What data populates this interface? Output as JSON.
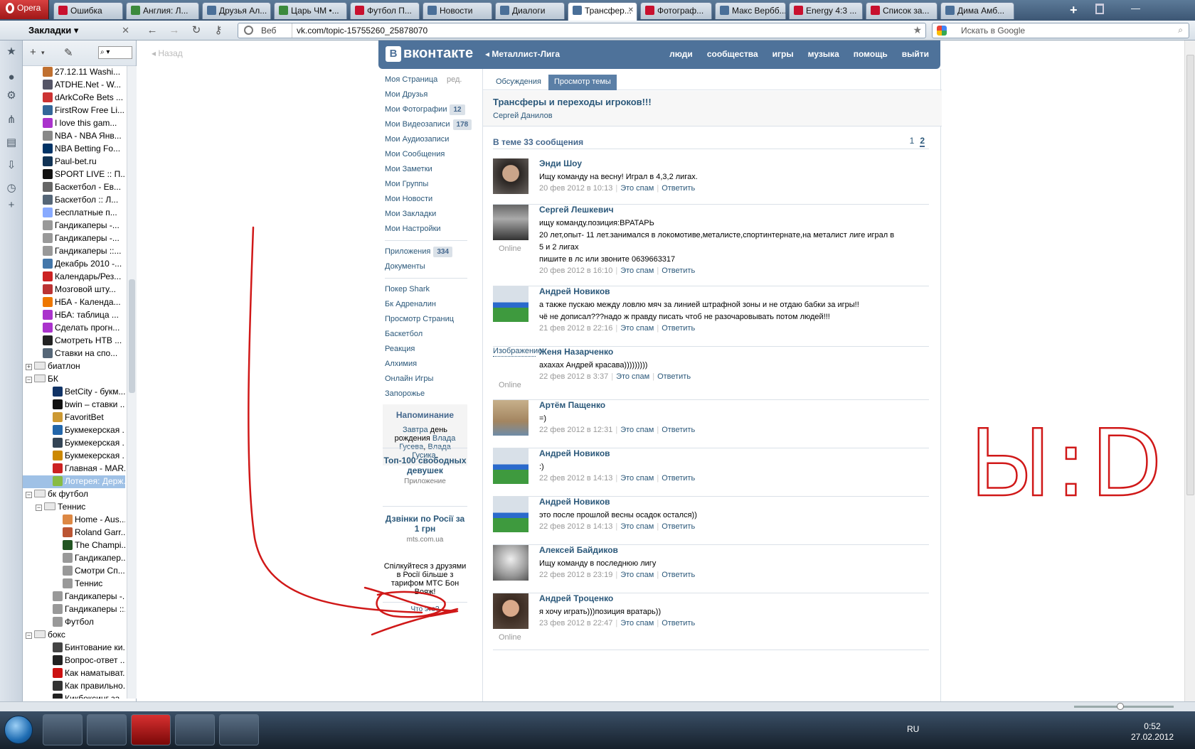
{
  "browser": {
    "menu_label": "Opera",
    "tabs": [
      {
        "label": "Ошибка",
        "icon": "opera-icon"
      },
      {
        "label": "Англия: Л...",
        "icon": "football-icon"
      },
      {
        "label": "Друзья Ал...",
        "icon": "vk-icon"
      },
      {
        "label": "Царь ЧМ •...",
        "icon": "football-icon"
      },
      {
        "label": "Футбол П...",
        "icon": "opera-icon"
      },
      {
        "label": "Новости",
        "icon": "vk-icon"
      },
      {
        "label": "Диалоги",
        "icon": "vk-icon"
      },
      {
        "label": "Трансфер...",
        "icon": "vk-icon"
      },
      {
        "label": "Фотограф...",
        "icon": "opera-icon"
      },
      {
        "label": "Макс Вербб...",
        "icon": "vk-icon"
      },
      {
        "label": "Energy 4:3 ...",
        "icon": "opera-icon"
      },
      {
        "label": "Список за...",
        "icon": "opera-icon"
      },
      {
        "label": "Дима Амб...",
        "icon": "vk-icon"
      }
    ],
    "bookmarks_title": "Закладки",
    "address_prefix": "Веб",
    "address": "vk.com/topic-15755260_25878070",
    "search_placeholder": "Искать в Google",
    "back_label": "Назад"
  },
  "bookmarks": [
    {
      "label": "27.12.11 Washi...",
      "color": "#c07030",
      "type": "item"
    },
    {
      "label": "ATDHE.Net - W...",
      "color": "#556",
      "type": "item"
    },
    {
      "label": "dArkCoRe Bets ...",
      "color": "#c33",
      "type": "item"
    },
    {
      "label": "FirstRow Free Li...",
      "color": "#369",
      "type": "item"
    },
    {
      "label": "I love this gam...",
      "color": "#a3c",
      "type": "item"
    },
    {
      "label": "NBA - NBA Янв...",
      "color": "#888",
      "type": "item"
    },
    {
      "label": "NBA Betting Fo...",
      "color": "#036",
      "type": "item"
    },
    {
      "label": "Paul-bet.ru",
      "color": "#135",
      "type": "item"
    },
    {
      "label": "SPORT LIVE :: П...",
      "color": "#111",
      "type": "item"
    },
    {
      "label": "Баскетбол - Ев...",
      "color": "#666",
      "type": "item"
    },
    {
      "label": "Баскетбол :: Л...",
      "color": "#567",
      "type": "item"
    },
    {
      "label": "Бесплатные п...",
      "color": "#8af",
      "type": "item"
    },
    {
      "label": "Гандикаперы -...",
      "color": "#999",
      "type": "item"
    },
    {
      "label": "Гандикаперы -...",
      "color": "#999",
      "type": "item"
    },
    {
      "label": "Гандикаперы ::...",
      "color": "#999",
      "type": "item"
    },
    {
      "label": "Декабрь 2010 -...",
      "color": "#47a",
      "type": "item"
    },
    {
      "label": "Календарь/Рез...",
      "color": "#c22",
      "type": "item"
    },
    {
      "label": "Мозговой шту...",
      "color": "#b33",
      "type": "item"
    },
    {
      "label": "НБА - Календа...",
      "color": "#e70",
      "type": "item"
    },
    {
      "label": "НБА: таблица ...",
      "color": "#a3c",
      "type": "item"
    },
    {
      "label": "Сделать прогн...",
      "color": "#a3c",
      "type": "item"
    },
    {
      "label": "Смотреть НТВ ...",
      "color": "#222",
      "type": "item"
    },
    {
      "label": "Ставки на спо...",
      "color": "#567",
      "type": "item"
    },
    {
      "label": "биатлон",
      "type": "folder",
      "exp": "+"
    },
    {
      "label": "БК",
      "type": "folder",
      "exp": "−"
    },
    {
      "label": "BetCity - букм...",
      "color": "#136",
      "type": "item",
      "indent": 1
    },
    {
      "label": "bwin – ставки ...",
      "color": "#111",
      "type": "item",
      "indent": 1
    },
    {
      "label": "FavoritBet",
      "color": "#c93",
      "type": "item",
      "indent": 1
    },
    {
      "label": "Букмекерская ...",
      "color": "#26a",
      "type": "item",
      "indent": 1
    },
    {
      "label": "Букмекерская ...",
      "color": "#345",
      "type": "item",
      "indent": 1
    },
    {
      "label": "Букмекерская ...",
      "color": "#c80",
      "type": "item",
      "indent": 1
    },
    {
      "label": "Главная - MAR...",
      "color": "#c22",
      "type": "item",
      "indent": 1
    },
    {
      "label": "Лотерея: Держ...",
      "color": "#8b4",
      "type": "item",
      "indent": 1,
      "selected": true
    },
    {
      "label": "бк футбол",
      "type": "folder",
      "exp": "−"
    },
    {
      "label": "Теннис",
      "type": "folder",
      "exp": "−",
      "indent": 1
    },
    {
      "label": "Home - Aus...",
      "color": "#d84",
      "type": "item",
      "indent": 2
    },
    {
      "label": "Roland Garr...",
      "color": "#b53",
      "type": "item",
      "indent": 2
    },
    {
      "label": "The Champi...",
      "color": "#252",
      "type": "item",
      "indent": 2
    },
    {
      "label": "Гандикапер...",
      "color": "#999",
      "type": "item",
      "indent": 2
    },
    {
      "label": "Смотри Сп...",
      "color": "#999",
      "type": "item",
      "indent": 2
    },
    {
      "label": "Теннис",
      "color": "#999",
      "type": "item",
      "indent": 2
    },
    {
      "label": "Гандикаперы -...",
      "color": "#999",
      "type": "item",
      "indent": 1
    },
    {
      "label": "Гандикаперы ::...",
      "color": "#999",
      "type": "item",
      "indent": 1
    },
    {
      "label": "Футбол",
      "color": "#999",
      "type": "item",
      "indent": 1
    },
    {
      "label": "бокс",
      "type": "folder",
      "exp": "−"
    },
    {
      "label": "Бинтование ки...",
      "color": "#444",
      "type": "item",
      "indent": 1
    },
    {
      "label": "Вопрос-ответ ...",
      "color": "#222",
      "type": "item",
      "indent": 1
    },
    {
      "label": "Как наматыват...",
      "color": "#c11",
      "type": "item",
      "indent": 1
    },
    {
      "label": "Как правильно...",
      "color": "#333",
      "type": "item",
      "indent": 1
    },
    {
      "label": "Кикбоксинг за...",
      "color": "#222",
      "type": "item",
      "indent": 1
    }
  ],
  "vk": {
    "logo": "вконтакте",
    "logo_mark": "В",
    "crumb": "Металлист-Лига",
    "nav": [
      "люди",
      "сообщества",
      "игры",
      "музыка",
      "помощь",
      "выйти"
    ],
    "menu": [
      {
        "label": "Моя Страница",
        "extra": "ред."
      },
      {
        "label": "Мои Друзья"
      },
      {
        "label": "Мои Фотографии",
        "count": "12"
      },
      {
        "label": "Мои Видеозаписи",
        "count": "178"
      },
      {
        "label": "Мои Аудиозаписи"
      },
      {
        "label": "Мои Сообщения"
      },
      {
        "label": "Мои Заметки"
      },
      {
        "label": "Мои Группы"
      },
      {
        "label": "Мои Новости"
      },
      {
        "label": "Мои Закладки"
      },
      {
        "label": "Мои Настройки"
      }
    ],
    "menu2": [
      {
        "label": "Приложения",
        "count": "334"
      },
      {
        "label": "Документы"
      }
    ],
    "apps": [
      "Покер Shark",
      "Бк Адреналин",
      "Просмотр Страниц",
      "Баскетбол",
      "Реакция",
      "Алхимия",
      "Онлайн Игры",
      "Запорожье"
    ],
    "reminder": {
      "title": "Напоминание",
      "w1": "Завтра",
      "w2": " день рождения ",
      "w3": "Влада Гусева",
      "w4": ", ",
      "w5": "Влада Гусика",
      "w6": "."
    },
    "ad1": {
      "title": "Топ-100 свободных девушек",
      "sub": "Приложение"
    },
    "ad2": {
      "title": "Дзвінки по Росії за 1 грн",
      "sub": "mts.com.ua",
      "body": "Спілкуйтеся з друзями в Росії більше з тарифом МТС Бон Вояж!",
      "link": "Что это?"
    }
  },
  "topic": {
    "tabs": [
      "Обсуждения",
      "Просмотр темы"
    ],
    "title": "Трансферы и переходы игроков!!!",
    "author": "Сергей Данилов",
    "count_label": "В теме 33 сообщения",
    "pages": [
      "1",
      "2"
    ],
    "spam_label": "Это спам",
    "reply_label": "Ответить",
    "online_label": "Online",
    "image_alt": "Изображение",
    "posts": [
      {
        "name": "Энди Шоу",
        "text": [
          "Ищу команду на весну! Играл в 4,3,2 лигах."
        ],
        "date": "20 фев 2012 в 10:13",
        "online": false,
        "ava": "face-dark"
      },
      {
        "name": "Сергей Лешкевич",
        "text": [
          "ищу команду.позиция:ВРАТАРЬ",
          "20 лет,опыт- 11 лет.занимался в локомотиве,металисте,спортинтернате,на металист лиге играл в",
          "5 и 2 лигах",
          "пишите в лс или звоните 0639663317"
        ],
        "date": "20 фев 2012 в 16:10",
        "online": true,
        "ava": "face-bw"
      },
      {
        "name": "Андрей Новиков",
        "text": [
          "а также пускаю между ловлю мяч за линией штрафной зоны и не отдаю бабки за игры!!",
          "чё не дописал???надо ж правду писать чтоб не разочаровывать потом людей!!!"
        ],
        "date": "21 фев 2012 в 22:16",
        "online": false,
        "ava": "footballer"
      },
      {
        "name": "Женя Назарченко",
        "text": [
          "ахахах Андрей красава)))))))))"
        ],
        "date": "22 фев 2012 в 3:37",
        "online": true,
        "ava": "broken"
      },
      {
        "name": "Артём Пащенко",
        "text": [
          "=)"
        ],
        "date": "22 фев 2012 в 12:31",
        "online": false,
        "ava": "beach"
      },
      {
        "name": "Андрей Новиков",
        "text": [
          ":)"
        ],
        "date": "22 фев 2012 в 14:13",
        "online": false,
        "ava": "footballer"
      },
      {
        "name": "Андрей Новиков",
        "text": [
          "это после прошлой весны осадок остался))"
        ],
        "date": "22 фев 2012 в 14:13",
        "online": false,
        "ava": "footballer"
      },
      {
        "name": "Алексей Байдиков",
        "text": [
          "Ищу команду в последнюю лигу"
        ],
        "date": "22 фев 2012 в 23:19",
        "online": false,
        "ava": "statue"
      },
      {
        "name": "Андрей Троценко",
        "text": [
          "я хочу играть)))позиция вратарь))"
        ],
        "date": "23 фев 2012 в 22:47",
        "online": true,
        "ava": "face-young"
      }
    ]
  },
  "annotation": {
    "scribble_text": "Ы:D",
    "color": "#d01818"
  },
  "taskbar": {
    "lang": "RU",
    "time": "0:52",
    "date": "27.02.2012"
  }
}
